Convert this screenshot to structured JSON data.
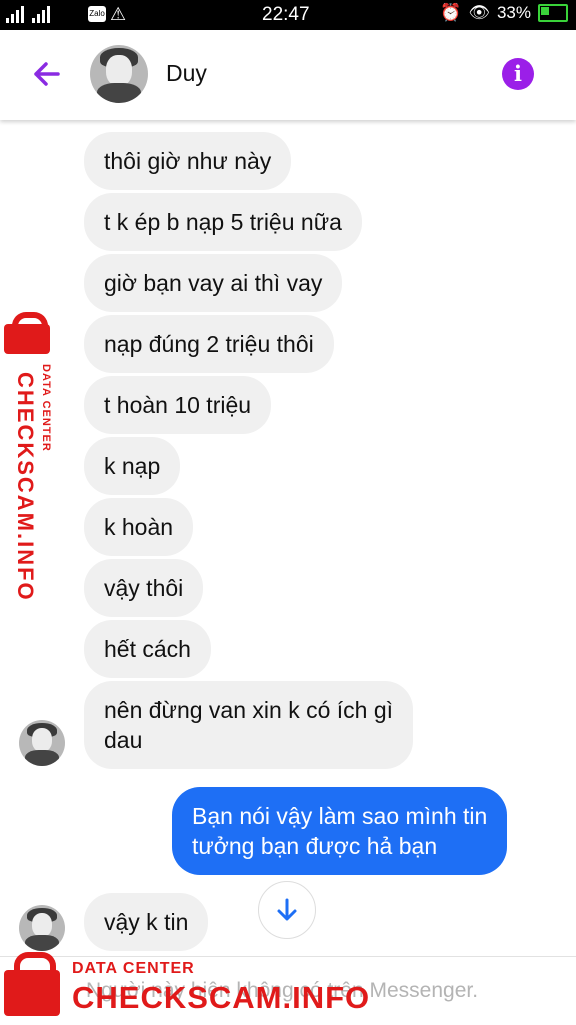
{
  "status_bar": {
    "carrier1": "",
    "carrier2": "",
    "zalo_icon": "Zalo",
    "time": "22:47",
    "battery": "33%"
  },
  "header": {
    "contact_name": "Duy",
    "accent_color": "#8a2be2"
  },
  "messages": [
    {
      "text": "thôi giờ như này",
      "from": "other"
    },
    {
      "text": "t k ép b nạp 5 triệu nữa",
      "from": "other"
    },
    {
      "text": "giờ bạn vay ai thì vay",
      "from": "other"
    },
    {
      "text": "nạp đúng 2 triệu thôi",
      "from": "other"
    },
    {
      "text": "t hoàn 10 triệu",
      "from": "other"
    },
    {
      "text": "k nạp",
      "from": "other"
    },
    {
      "text": "k hoàn",
      "from": "other"
    },
    {
      "text": "vậy thôi",
      "from": "other"
    },
    {
      "text": "hết cách",
      "from": "other"
    },
    {
      "text": "nên đừng van xin k có ích gì\ndau",
      "from": "other"
    },
    {
      "text": "Bạn nói vậy làm sao mình tin\ntưởng bạn được hả bạn",
      "from": "me"
    },
    {
      "text": "vậy k tin",
      "from": "other"
    }
  ],
  "composer": {
    "placeholder": "Người này hiện không có trên Messenger."
  },
  "watermark": {
    "small": "DATA CENTER",
    "big": "CHECKSCAM.INFO"
  },
  "colors": {
    "my_bubble": "#1e6ff5",
    "their_bubble": "#f0f0f0",
    "watermark": "#e01a1a"
  }
}
